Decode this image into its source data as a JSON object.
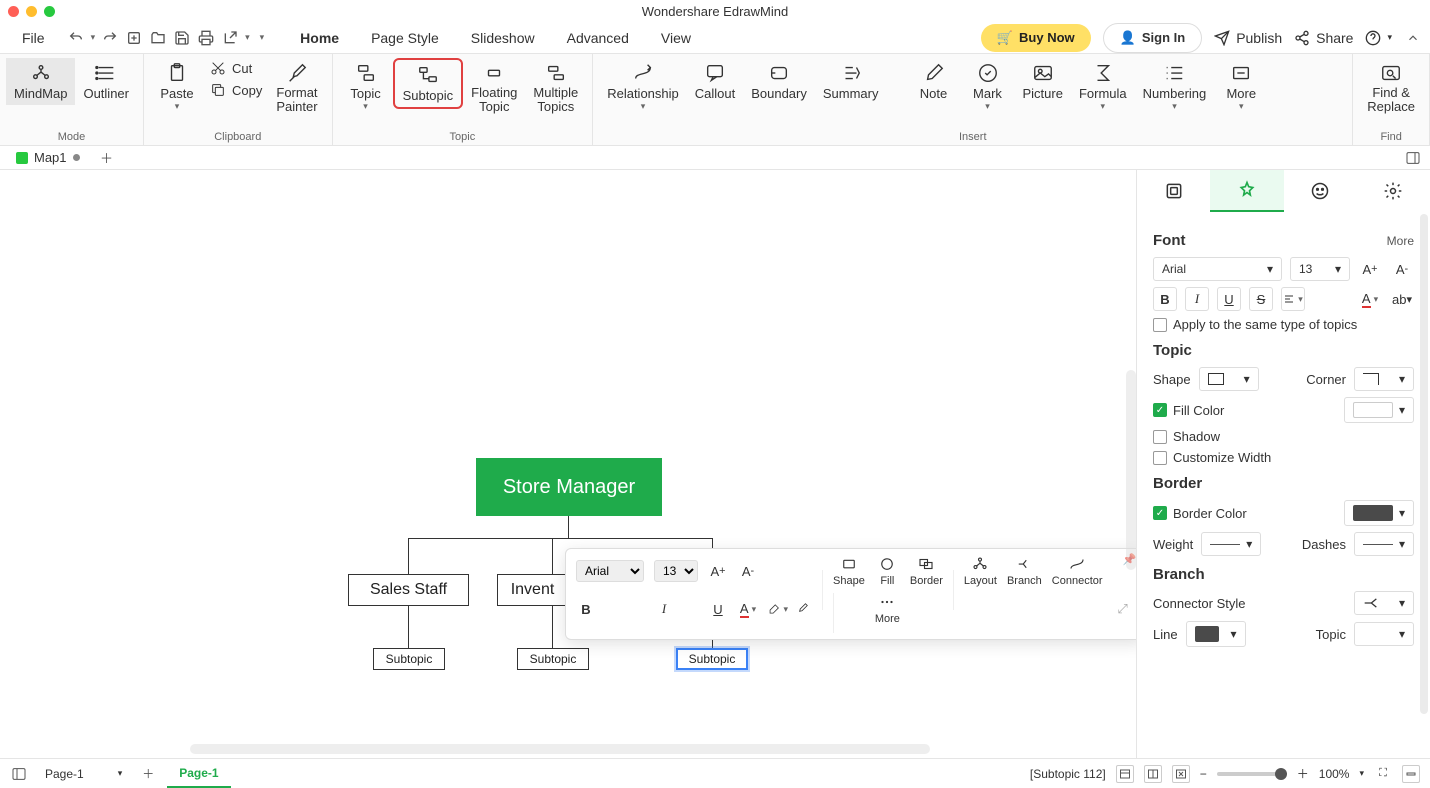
{
  "app": {
    "title": "Wondershare EdrawMind"
  },
  "menu": {
    "file": "File",
    "tabs": [
      "Home",
      "Page Style",
      "Slideshow",
      "Advanced",
      "View"
    ],
    "active_tab": "Home",
    "buy_now": "Buy Now",
    "sign_in": "Sign In",
    "publish": "Publish",
    "share": "Share"
  },
  "ribbon": {
    "mode_label": "Mode",
    "mindmap": "MindMap",
    "outliner": "Outliner",
    "paste": "Paste",
    "cut": "Cut",
    "copy": "Copy",
    "clipboard_label": "Clipboard",
    "format_painter": "Format\nPainter",
    "topic": "Topic",
    "subtopic": "Subtopic",
    "floating_topic": "Floating\nTopic",
    "multiple_topics": "Multiple\nTopics",
    "topic_label": "Topic",
    "relationship": "Relationship",
    "callout": "Callout",
    "boundary": "Boundary",
    "summary": "Summary",
    "note": "Note",
    "mark": "Mark",
    "picture": "Picture",
    "formula": "Formula",
    "numbering": "Numbering",
    "more": "More",
    "insert_label": "Insert",
    "find_replace": "Find &\nReplace",
    "find_label": "Find"
  },
  "doc_tabs": {
    "map1": "Map1"
  },
  "mindmap": {
    "root": "Store Manager",
    "child1": "Sales Staff",
    "child2": "Invent",
    "sub1": "Subtopic",
    "sub2": "Subtopic",
    "sub3": "Subtopic"
  },
  "float_toolbar": {
    "font": "Arial",
    "size": "13",
    "shape": "Shape",
    "fill": "Fill",
    "border": "Border",
    "layout": "Layout",
    "branch": "Branch",
    "connector": "Connector",
    "more": "More"
  },
  "panel": {
    "font_title": "Font",
    "font_more": "More",
    "font_family": "Arial",
    "font_size": "13",
    "apply_same": "Apply to the same type of topics",
    "topic_title": "Topic",
    "shape_label": "Shape",
    "corner_label": "Corner",
    "fill_color": "Fill Color",
    "shadow": "Shadow",
    "customize_width": "Customize Width",
    "border_title": "Border",
    "border_color": "Border Color",
    "weight": "Weight",
    "dashes": "Dashes",
    "branch_title": "Branch",
    "connector_style": "Connector Style",
    "line": "Line",
    "topic_label": "Topic"
  },
  "status": {
    "page": "Page-1",
    "page_tab": "Page-1",
    "selection": "[Subtopic 112]",
    "zoom": "100%"
  }
}
